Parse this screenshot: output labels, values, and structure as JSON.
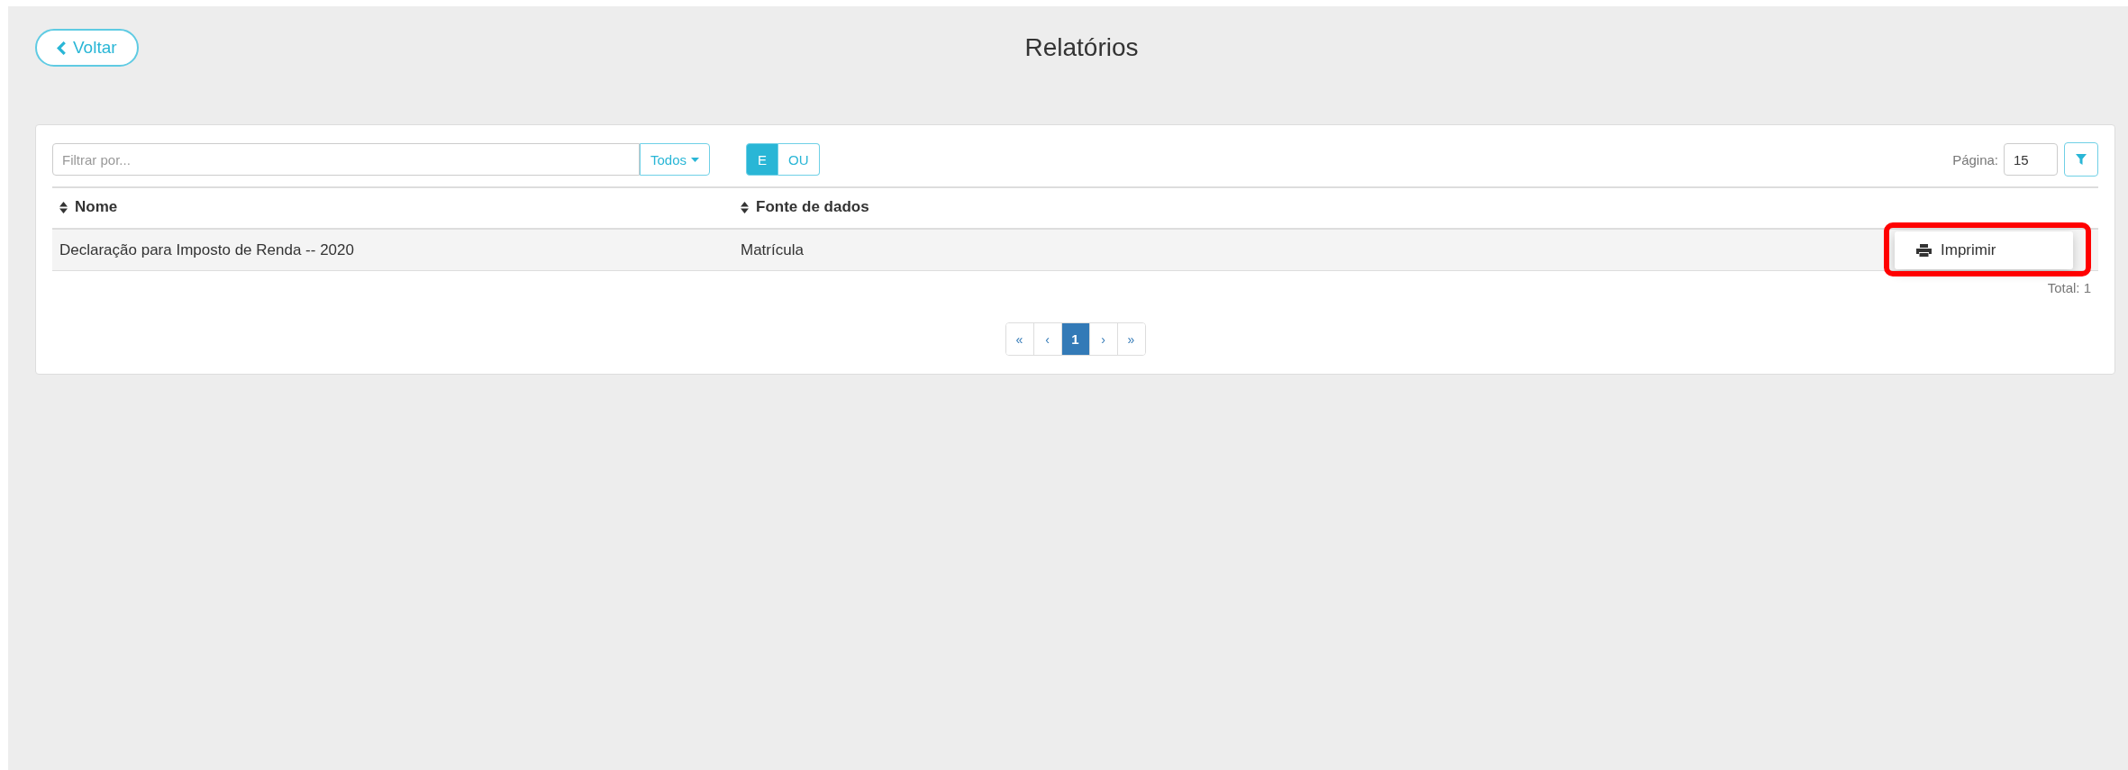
{
  "back_button": {
    "label": "Voltar"
  },
  "title": "Relatórios",
  "filter": {
    "placeholder": "Filtrar por...",
    "dropdown": "Todos",
    "logic": [
      {
        "label": "E",
        "selected": true
      },
      {
        "label": "OU",
        "selected": false
      }
    ],
    "page_label": "Página:",
    "page_size": "15"
  },
  "table": {
    "columns": [
      "Nome",
      "Fonte de dados"
    ],
    "rows": [
      {
        "cells": [
          "Declaração para Imposto de Renda -- 2020",
          "Matrícula"
        ],
        "menu": {
          "item": "Imprimir",
          "highlighted": true
        }
      }
    ]
  },
  "total": "Total: 1",
  "pagination": [
    {
      "label": "«",
      "selected": false
    },
    {
      "label": "‹",
      "selected": false
    },
    {
      "label": "1",
      "selected": true
    },
    {
      "label": "›",
      "selected": false
    },
    {
      "label": "»",
      "selected": false
    }
  ]
}
